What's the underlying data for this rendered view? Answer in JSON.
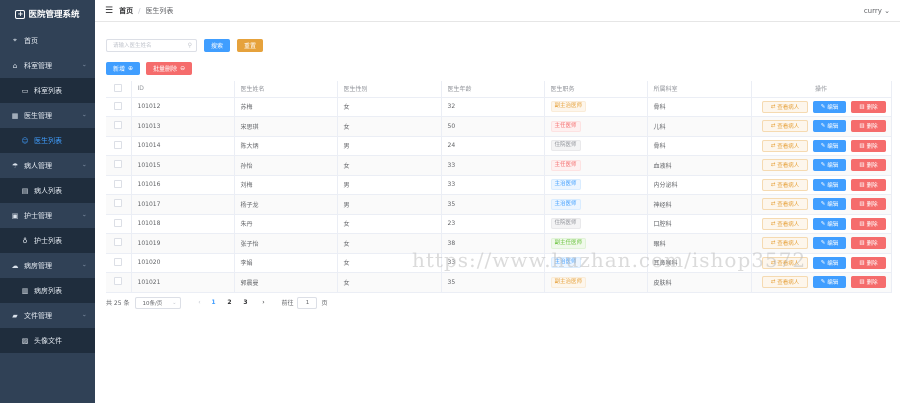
{
  "app": {
    "title": "医院管理系统"
  },
  "sidebar": {
    "items": [
      {
        "label": "首页",
        "icon": "location-icon"
      },
      {
        "label": "科室管理",
        "icon": "home-icon",
        "children": [
          {
            "label": "科室列表",
            "icon": "monitor-icon"
          }
        ]
      },
      {
        "label": "医生管理",
        "icon": "grid-icon",
        "children": [
          {
            "label": "医生列表",
            "icon": "user-icon",
            "active": true
          }
        ]
      },
      {
        "label": "病人管理",
        "icon": "umbrella-icon",
        "children": [
          {
            "label": "病人列表",
            "icon": "document-icon"
          }
        ]
      },
      {
        "label": "护士管理",
        "icon": "suitcase-icon",
        "children": [
          {
            "label": "护士列表",
            "icon": "bulb-icon"
          }
        ]
      },
      {
        "label": "病房管理",
        "icon": "cloud-icon",
        "children": [
          {
            "label": "病房列表",
            "icon": "notebook-icon"
          }
        ]
      },
      {
        "label": "文件管理",
        "icon": "folder-icon",
        "children": [
          {
            "label": "头像文件",
            "icon": "picture-icon"
          }
        ]
      }
    ]
  },
  "header": {
    "breadcrumb": {
      "home": "首页",
      "separator": "/",
      "current": "医生列表"
    },
    "user": "curry"
  },
  "toolbar": {
    "search_placeholder": "请输入医生姓名",
    "search_label": "搜索",
    "reset_label": "重置",
    "add_label": "新增",
    "batch_delete_label": "批量删除"
  },
  "table": {
    "columns": [
      "ID",
      "医生姓名",
      "医生性别",
      "医生年龄",
      "医生职务",
      "所属科室",
      "操作"
    ],
    "rows": [
      {
        "id": "101012",
        "name": "苏梅",
        "gender": "女",
        "age": "32",
        "title": "副主治医师",
        "title_type": "warning",
        "dept": "骨科"
      },
      {
        "id": "101013",
        "name": "宋思琪",
        "gender": "女",
        "age": "50",
        "title": "主任医师",
        "title_type": "danger",
        "dept": "儿科"
      },
      {
        "id": "101014",
        "name": "陈大炳",
        "gender": "男",
        "age": "24",
        "title": "住院医师",
        "title_type": "info",
        "dept": "骨科"
      },
      {
        "id": "101015",
        "name": "孙怡",
        "gender": "女",
        "age": "33",
        "title": "主任医师",
        "title_type": "danger",
        "dept": "血液科"
      },
      {
        "id": "101016",
        "name": "刘梅",
        "gender": "男",
        "age": "33",
        "title": "主治医师",
        "title_type": "primary",
        "dept": "内分泌科"
      },
      {
        "id": "101017",
        "name": "杨子龙",
        "gender": "男",
        "age": "35",
        "title": "主治医师",
        "title_type": "primary",
        "dept": "神经科"
      },
      {
        "id": "101018",
        "name": "朱丹",
        "gender": "女",
        "age": "23",
        "title": "住院医师",
        "title_type": "info",
        "dept": "口腔科"
      },
      {
        "id": "101019",
        "name": "张子怡",
        "gender": "女",
        "age": "38",
        "title": "副主任医师",
        "title_type": "success",
        "dept": "眼科"
      },
      {
        "id": "101020",
        "name": "李娟",
        "gender": "女",
        "age": "33",
        "title": "主治医师",
        "title_type": "primary",
        "dept": "耳鼻喉科"
      },
      {
        "id": "101021",
        "name": "郭晨曼",
        "gender": "女",
        "age": "35",
        "title": "副主治医师",
        "title_type": "warning",
        "dept": "皮肤科"
      }
    ],
    "actions": {
      "view": "查看病人",
      "edit": "编辑",
      "delete": "删除"
    }
  },
  "pagination": {
    "total": "共 25 条",
    "page_size": "10条/页",
    "pages": [
      "1",
      "2",
      "3"
    ],
    "current_page": "1",
    "goto_label": "前往",
    "goto_value": "1",
    "page_suffix": "页"
  },
  "watermark": "https://www.huzhan.com/ishop3572",
  "colors": {
    "sidebar_bg": "#304156",
    "primary": "#409eff",
    "warning": "#e6a23c",
    "danger": "#f56c6c"
  }
}
